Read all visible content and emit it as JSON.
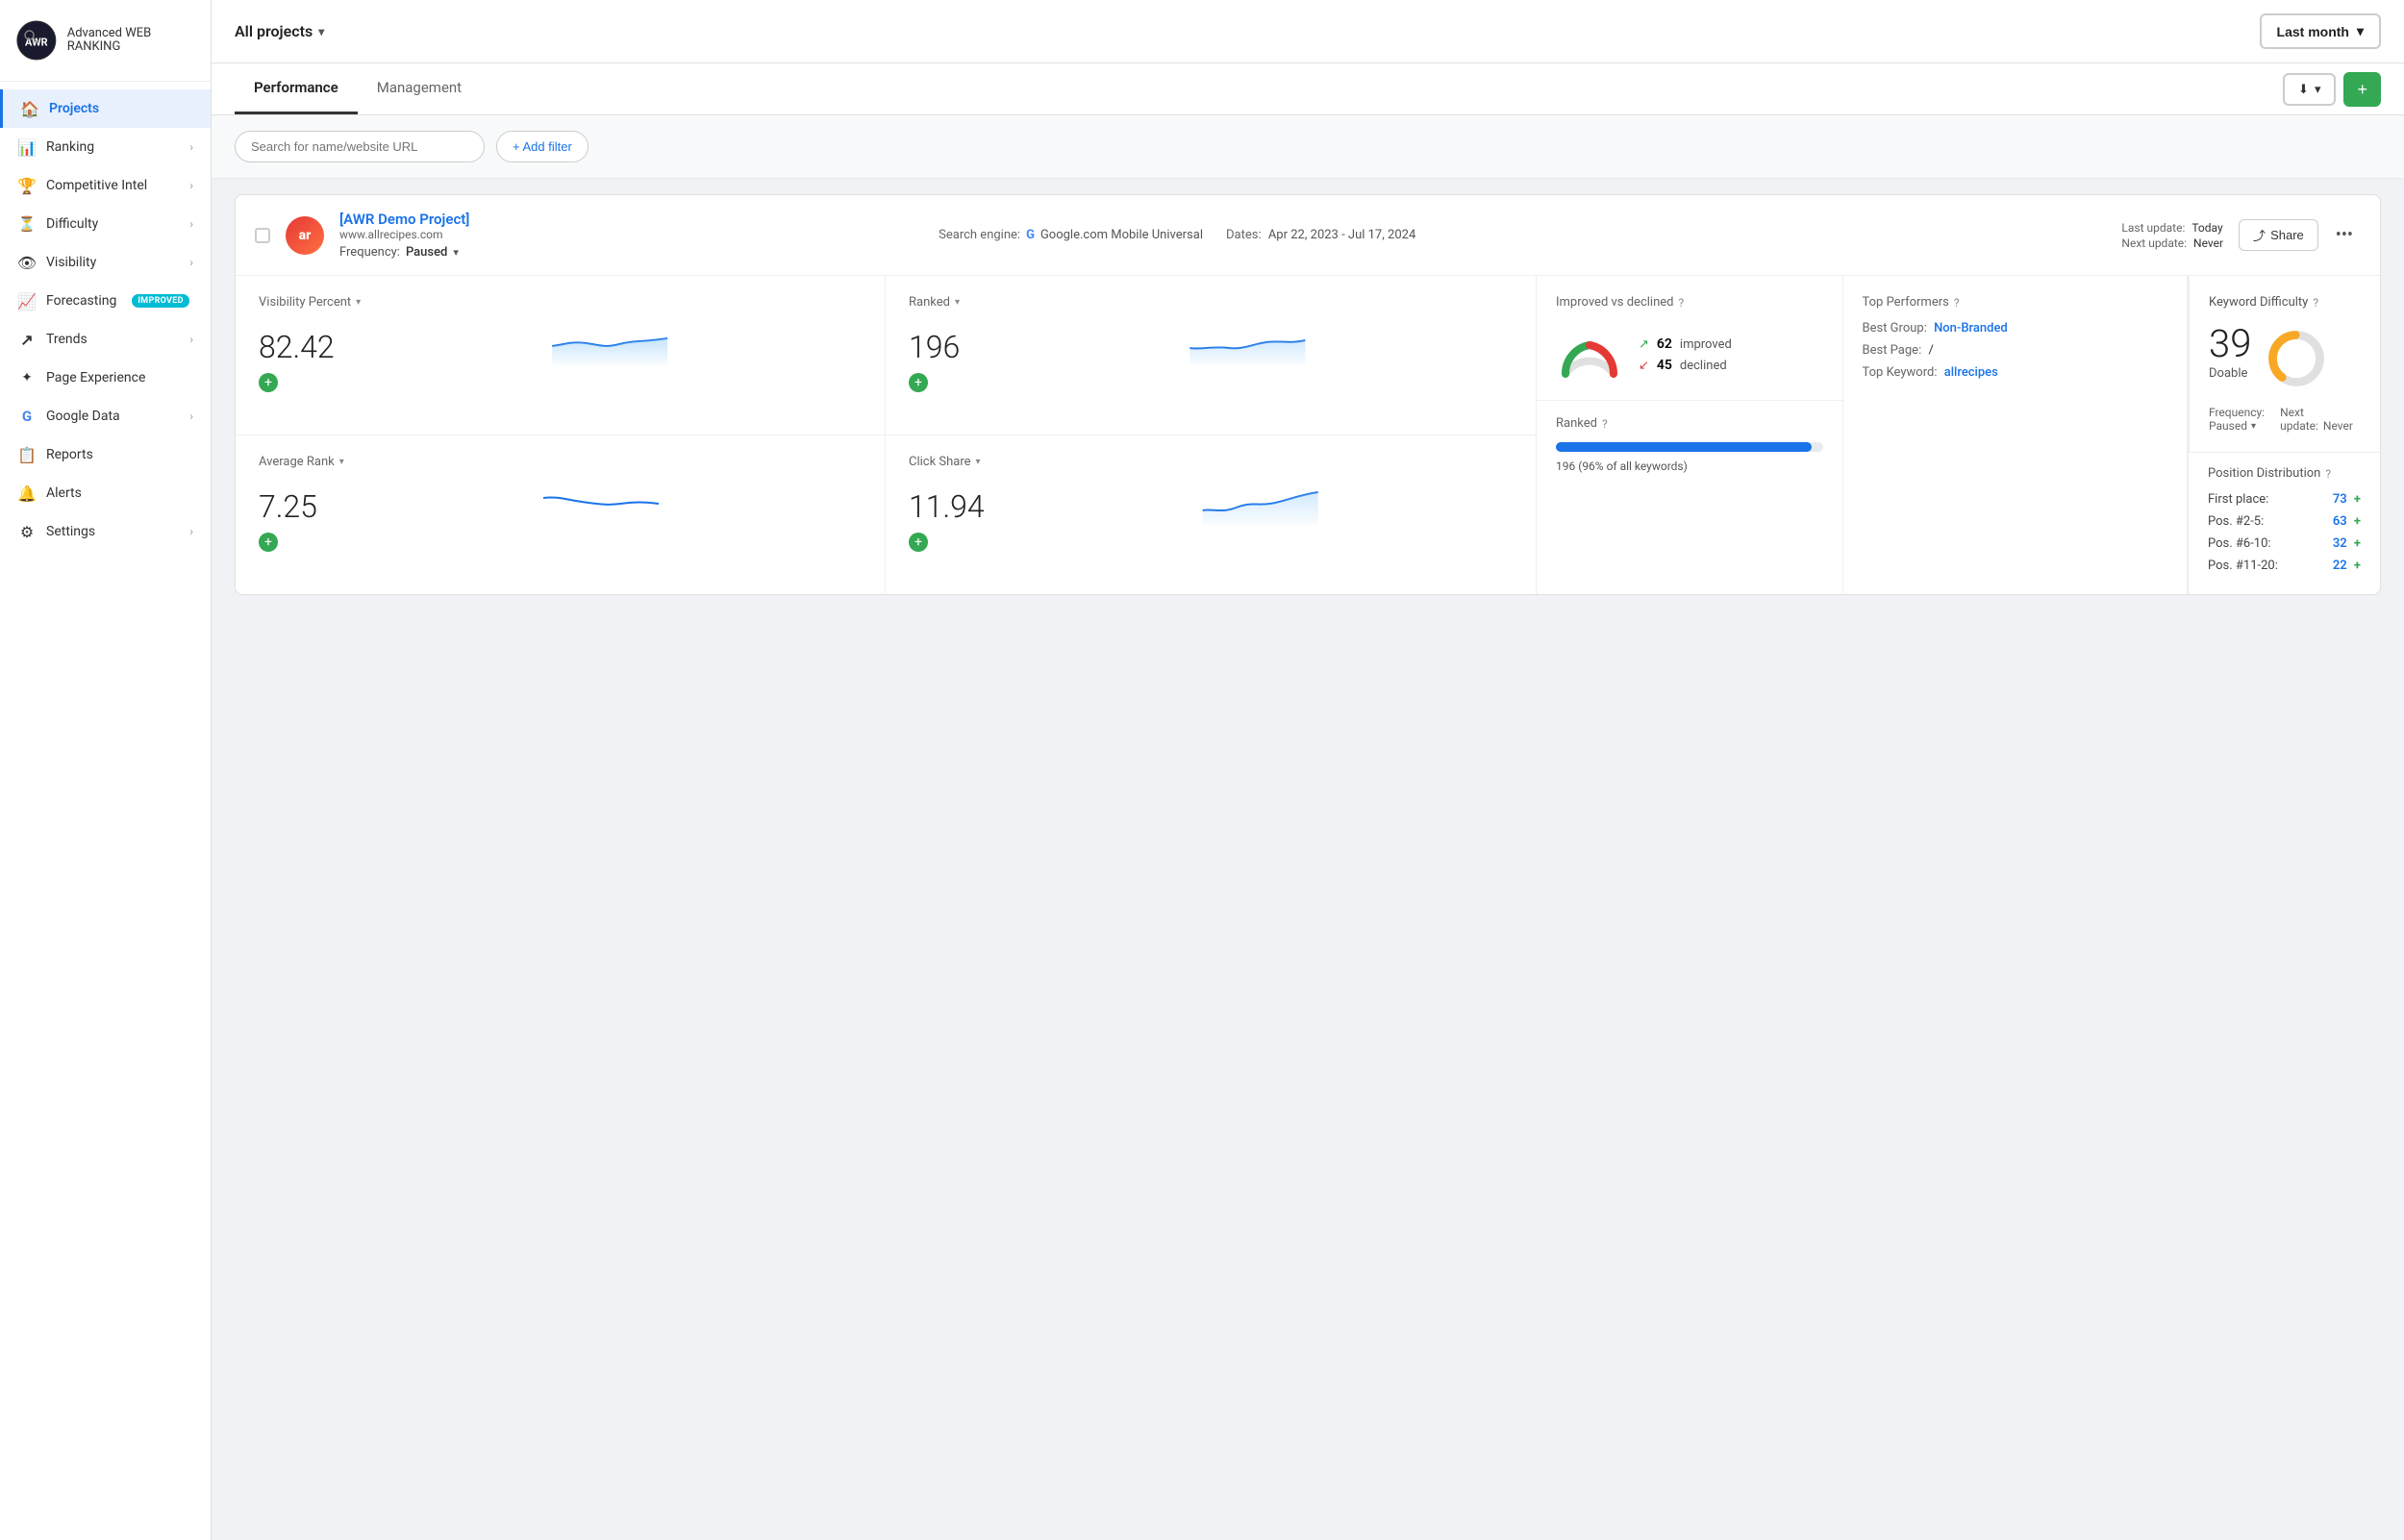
{
  "app": {
    "name": "Advanced WEB RANKING",
    "logo_initials": "AWR"
  },
  "sidebar": {
    "items": [
      {
        "id": "projects",
        "label": "Projects",
        "icon": "🏠",
        "active": true,
        "hasChevron": false
      },
      {
        "id": "ranking",
        "label": "Ranking",
        "icon": "📊",
        "active": false,
        "hasChevron": true
      },
      {
        "id": "competitive-intel",
        "label": "Competitive Intel",
        "icon": "🏆",
        "active": false,
        "hasChevron": true
      },
      {
        "id": "difficulty",
        "label": "Difficulty",
        "icon": "⏳",
        "active": false,
        "hasChevron": true
      },
      {
        "id": "visibility",
        "label": "Visibility",
        "icon": "👁",
        "active": false,
        "hasChevron": true
      },
      {
        "id": "forecasting",
        "label": "Forecasting",
        "icon": "📈",
        "active": false,
        "hasChevron": false,
        "badge": "IMPROVED"
      },
      {
        "id": "trends",
        "label": "Trends",
        "icon": "↗",
        "active": false,
        "hasChevron": true
      },
      {
        "id": "page-experience",
        "label": "Page Experience",
        "icon": "✦",
        "active": false,
        "hasChevron": false
      },
      {
        "id": "google-data",
        "label": "Google Data",
        "icon": "G",
        "active": false,
        "hasChevron": true
      },
      {
        "id": "reports",
        "label": "Reports",
        "icon": "📋",
        "active": false,
        "hasChevron": false
      },
      {
        "id": "alerts",
        "label": "Alerts",
        "icon": "🔔",
        "active": false,
        "hasChevron": false
      },
      {
        "id": "settings",
        "label": "Settings",
        "icon": "⚙",
        "active": false,
        "hasChevron": true
      }
    ]
  },
  "topbar": {
    "projects_label": "All projects",
    "date_range_label": "Last month",
    "dropdown_arrow": "▾"
  },
  "tabs": {
    "items": [
      {
        "id": "performance",
        "label": "Performance",
        "active": true
      },
      {
        "id": "management",
        "label": "Management",
        "active": false
      }
    ],
    "download_label": "⬇",
    "add_label": "+"
  },
  "filter_bar": {
    "search_placeholder": "Search for name/website URL",
    "add_filter_label": "+ Add filter"
  },
  "project": {
    "name": "[AWR Demo Project]",
    "url": "www.allrecipes.com",
    "avatar_text": "ar",
    "search_engine": "Google.com Mobile Universal",
    "dates": "Apr 22, 2023 - Jul 17, 2024",
    "frequency_label": "Frequency:",
    "frequency_value": "Paused",
    "last_update_label": "Last update:",
    "last_update_value": "Today",
    "next_update_label": "Next update:",
    "next_update_value": "Never",
    "share_label": "Share",
    "more_label": "•••",
    "stats": {
      "visibility_percent": {
        "label": "Visibility Percent",
        "value": "82.42"
      },
      "ranked": {
        "label": "Ranked",
        "value": "196"
      },
      "average_rank": {
        "label": "Average Rank",
        "value": "7.25"
      },
      "click_share": {
        "label": "Click Share",
        "value": "11.94"
      }
    },
    "improved_vs_declined": {
      "title": "Improved vs declined",
      "improved_count": "62",
      "improved_label": "improved",
      "declined_count": "45",
      "declined_label": "declined"
    },
    "ranked_bar": {
      "title": "Ranked",
      "value": "196",
      "percent": "96",
      "note": "196 (96% of all keywords)",
      "bar_width": "96"
    },
    "top_performers": {
      "title": "Top Performers",
      "best_group_label": "Best Group:",
      "best_group_value": "Non-Branded",
      "best_page_label": "Best Page:",
      "best_page_value": "/",
      "top_keyword_label": "Top Keyword:",
      "top_keyword_value": "allrecipes"
    },
    "keyword_difficulty": {
      "title": "Keyword Difficulty",
      "score": "39",
      "label": "Doable",
      "donut_filled": "39",
      "donut_total": "100"
    },
    "frequency_detail": {
      "paused_label": "Paused",
      "next_label": "Next",
      "update_label": "update:",
      "update_value": "Never"
    },
    "position_distribution": {
      "title": "Position Distribution",
      "rows": [
        {
          "label": "First place:",
          "value": "73",
          "plus": "+"
        },
        {
          "label": "Pos. #2-5:",
          "value": "63",
          "plus": "+"
        },
        {
          "label": "Pos. #6-10:",
          "value": "32",
          "plus": "+"
        },
        {
          "label": "Pos. #11-20:",
          "value": "22",
          "plus": "+"
        }
      ]
    }
  }
}
